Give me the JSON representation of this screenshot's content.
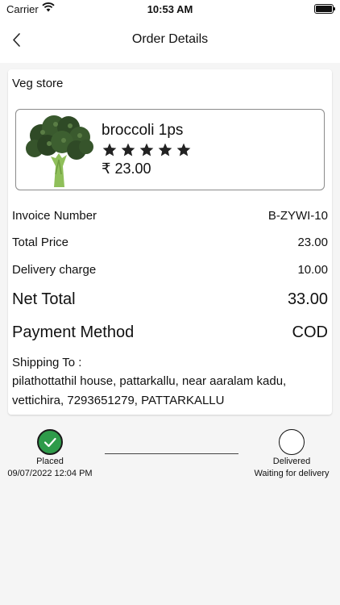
{
  "status_bar": {
    "carrier": "Carrier",
    "time": "10:53 AM"
  },
  "nav": {
    "title": "Order Details",
    "back_icon": "chevron-left-icon"
  },
  "store": {
    "name": "Veg store"
  },
  "product": {
    "name": "broccoli 1ps",
    "rating": 5,
    "currency": "₹",
    "price": "23.00",
    "price_display": "₹ 23.00",
    "image_icon": "broccoli-image"
  },
  "summary": {
    "invoice_label": "Invoice Number",
    "invoice_value": "B-ZYWI-10",
    "total_label": "Total Price",
    "total_value": "23.00",
    "delivery_label": "Delivery charge",
    "delivery_value": "10.00",
    "net_label": "Net Total",
    "net_value": "33.00",
    "payment_label": "Payment Method",
    "payment_value": "COD"
  },
  "shipping": {
    "label": "Shipping To :",
    "address": "pilathottathil house, pattarkallu, near aaralam kadu, vettichira, 7293651279, PATTARKALLU"
  },
  "tracking": {
    "placed_label": "Placed",
    "placed_time": "09/07/2022 12:04 PM",
    "delivered_label": "Delivered",
    "delivered_status": "Waiting for delivery",
    "done_color": "#2e9b4a"
  }
}
